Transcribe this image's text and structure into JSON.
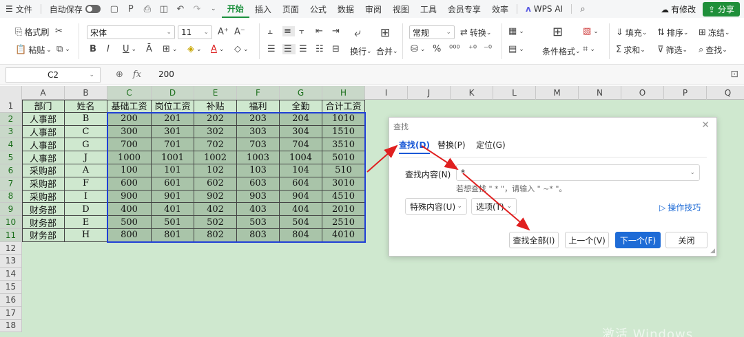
{
  "menubar": {
    "file": "文件",
    "autosave": "自动保存",
    "tabs": [
      "开始",
      "插入",
      "页面",
      "公式",
      "数据",
      "审阅",
      "视图",
      "工具",
      "会员专享",
      "效率"
    ],
    "active_tab": "开始",
    "wps_ai": "WPS AI",
    "modify": "有修改",
    "share": "分享"
  },
  "ribbon": {
    "format_painter": "格式刷",
    "paste": "粘贴",
    "font_name": "宋体",
    "font_size": "11",
    "number_format": "常规",
    "convert": "转换",
    "wrap": "换行",
    "merge": "合并",
    "conditional_format": "条件格式",
    "fill": "填充",
    "sort": "排序",
    "freeze": "冻结",
    "sum": "求和",
    "filter": "筛选",
    "find": "查找"
  },
  "formula_bar": {
    "cell_ref": "C2",
    "value": "200"
  },
  "sheet": {
    "columns": [
      "A",
      "B",
      "C",
      "D",
      "E",
      "F",
      "G",
      "H",
      "I",
      "J",
      "K",
      "L",
      "M",
      "N",
      "O",
      "P",
      "Q"
    ],
    "row_numbers": [
      "1",
      "2",
      "3",
      "4",
      "5",
      "6",
      "7",
      "8",
      "9",
      "10",
      "11",
      "12",
      "13",
      "14",
      "15",
      "16",
      "17",
      "18"
    ],
    "header": [
      "部门",
      "姓名",
      "基础工资",
      "岗位工资",
      "补贴",
      "福利",
      "全勤",
      "合计工资"
    ],
    "rows": [
      [
        "人事部",
        "B",
        "200",
        "201",
        "202",
        "203",
        "204",
        "1010"
      ],
      [
        "人事部",
        "C",
        "300",
        "301",
        "302",
        "303",
        "304",
        "1510"
      ],
      [
        "人事部",
        "G",
        "700",
        "701",
        "702",
        "703",
        "704",
        "3510"
      ],
      [
        "人事部",
        "J",
        "1000",
        "1001",
        "1002",
        "1003",
        "1004",
        "5010"
      ],
      [
        "采购部",
        "A",
        "100",
        "101",
        "102",
        "103",
        "104",
        "510"
      ],
      [
        "采购部",
        "F",
        "600",
        "601",
        "602",
        "603",
        "604",
        "3010"
      ],
      [
        "采购部",
        "I",
        "900",
        "901",
        "902",
        "903",
        "904",
        "4510"
      ],
      [
        "财务部",
        "D",
        "400",
        "401",
        "402",
        "403",
        "404",
        "2010"
      ],
      [
        "财务部",
        "E",
        "500",
        "501",
        "502",
        "503",
        "504",
        "2510"
      ],
      [
        "财务部",
        "H",
        "800",
        "801",
        "802",
        "803",
        "804",
        "4010"
      ]
    ]
  },
  "dialog": {
    "title": "查找",
    "tabs": [
      "查找(D)",
      "替换(P)",
      "定位(G)"
    ],
    "find_label": "查找内容(N)",
    "find_value": "*",
    "hint": "若想查找 \" * \"，请输入 \" ~* \"。",
    "special_content": "特殊内容(U)",
    "options": "选项(T)",
    "tips": "操作技巧",
    "buttons": [
      "查找全部(I)",
      "上一个(V)",
      "下一个(F)",
      "关闭"
    ]
  },
  "colors": {
    "accent": "#1a8f3c",
    "selection_border": "#1f3fd6",
    "annotation_arrow": "#e02020",
    "sheet_bg": "#cfe8cf"
  },
  "watermark": "激活 Windows"
}
